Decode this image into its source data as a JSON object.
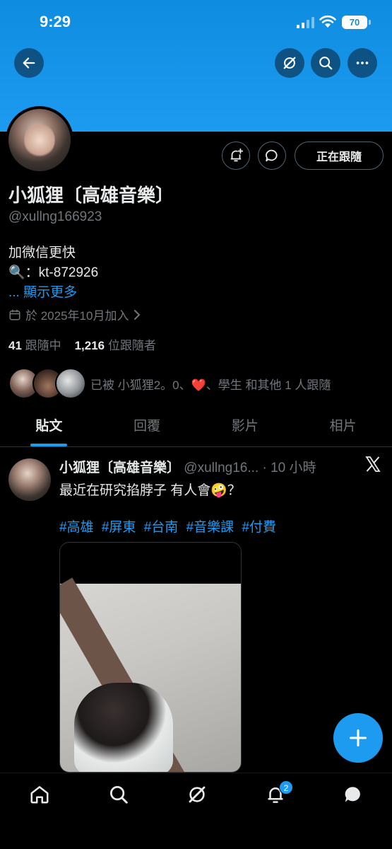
{
  "status": {
    "time": "9:29",
    "battery": "70"
  },
  "profile": {
    "name": "小狐狸〔高雄音樂〕",
    "handle": "@xullng166923",
    "bio_lines": [
      "加微信更快",
      "🔍：kt-872926"
    ],
    "show_more": "... 顯示更多",
    "joined": "於 2025年10月加入",
    "following_count": "41",
    "following_label": "跟隨中",
    "followers_count": "1,216",
    "followers_label": "位跟隨者",
    "followed_by": "已被 小狐狸2。0、❤️、學生 和其他 1 人跟隨",
    "following_button": "正在跟隨"
  },
  "tabs": [
    {
      "label": "貼文",
      "active": true
    },
    {
      "label": "回覆"
    },
    {
      "label": "影片"
    },
    {
      "label": "相片"
    }
  ],
  "tweet": {
    "name": "小狐狸〔高雄音樂〕",
    "meta": "@xullng16... · 10 小時",
    "text": "最近在研究掐脖子 有人會🤪？",
    "hashtags": [
      "#高雄",
      "#屏東",
      "#台南",
      "#音樂課",
      "#付費"
    ]
  },
  "nav": {
    "notifications_badge": "2"
  },
  "colors": {
    "accent": "#1d9bf0",
    "banner": "#1d9bf0",
    "background": "#000000"
  }
}
